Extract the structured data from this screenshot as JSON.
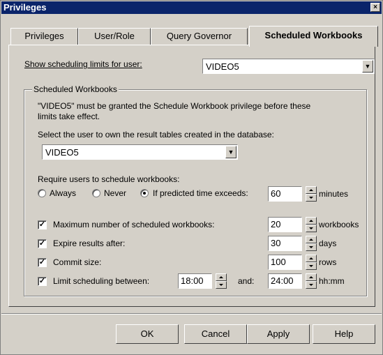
{
  "window": {
    "title": "Privileges",
    "close": "×"
  },
  "tabs": [
    {
      "label": "Privileges"
    },
    {
      "label": "User/Role"
    },
    {
      "label": "Query Governor"
    },
    {
      "label": "Scheduled Workbooks",
      "active": true
    }
  ],
  "show_limits": {
    "label": "Show scheduling limits for user:",
    "value": "VIDEO5"
  },
  "group": {
    "title": "Scheduled Workbooks",
    "notice_line1": "\"VIDEO5\" must be granted the Schedule Workbook privilege before these",
    "notice_line2": "limits take effect.",
    "owner_label": "Select the user to own the result tables created in the database:",
    "owner_value": "VIDEO5",
    "require_label": "Require users to schedule workbooks:",
    "radio_always": "Always",
    "radio_never": "Never",
    "radio_predicted": "If predicted time exceeds:",
    "radio_selected": "predicted",
    "predicted_value": "60",
    "predicted_unit": "minutes",
    "max_workbooks": {
      "label": "Maximum number of scheduled workbooks:",
      "checked": true,
      "value": "20",
      "unit": "workbooks"
    },
    "expire": {
      "label": "Expire results after:",
      "checked": true,
      "value": "30",
      "unit": "days"
    },
    "commit": {
      "label": "Commit size:",
      "checked": true,
      "value": "100",
      "unit": "rows"
    },
    "limit": {
      "label": "Limit scheduling between:",
      "checked": true,
      "from": "18:00",
      "and_label": "and:",
      "to": "24:00",
      "unit": "hh:mm"
    }
  },
  "buttons": {
    "ok": "OK",
    "cancel": "Cancel",
    "apply": "Apply",
    "help": "Help"
  }
}
